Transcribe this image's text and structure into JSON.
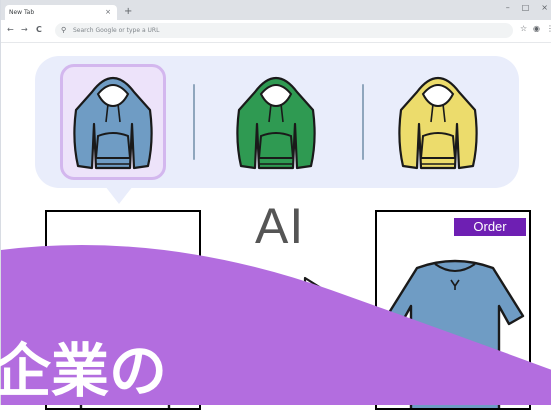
{
  "browser": {
    "tab_title": "New Tab",
    "tab_close": "×",
    "new_tab": "+",
    "window_controls": {
      "minimize": "–",
      "maximize": "□",
      "close": "×"
    },
    "nav": {
      "back": "←",
      "forward": "→",
      "reload": "C"
    },
    "omnibox_placeholder": "Search Google or type a URL",
    "toolbar_icons": {
      "bookmark": "☆",
      "profile": "◉",
      "menu": "⋮"
    }
  },
  "variants": [
    {
      "color_name": "blue",
      "fill": "#6f9cc4",
      "selected": true
    },
    {
      "color_name": "green",
      "fill": "#2f9a52",
      "selected": false
    },
    {
      "color_name": "yellow",
      "fill": "#ecdc6c",
      "selected": false
    }
  ],
  "ai_label": "AI",
  "result": {
    "order_button": "Order",
    "fill": "#6f9cc4"
  },
  "overlay": {
    "text": "企業の",
    "color": "#b36ddf"
  }
}
